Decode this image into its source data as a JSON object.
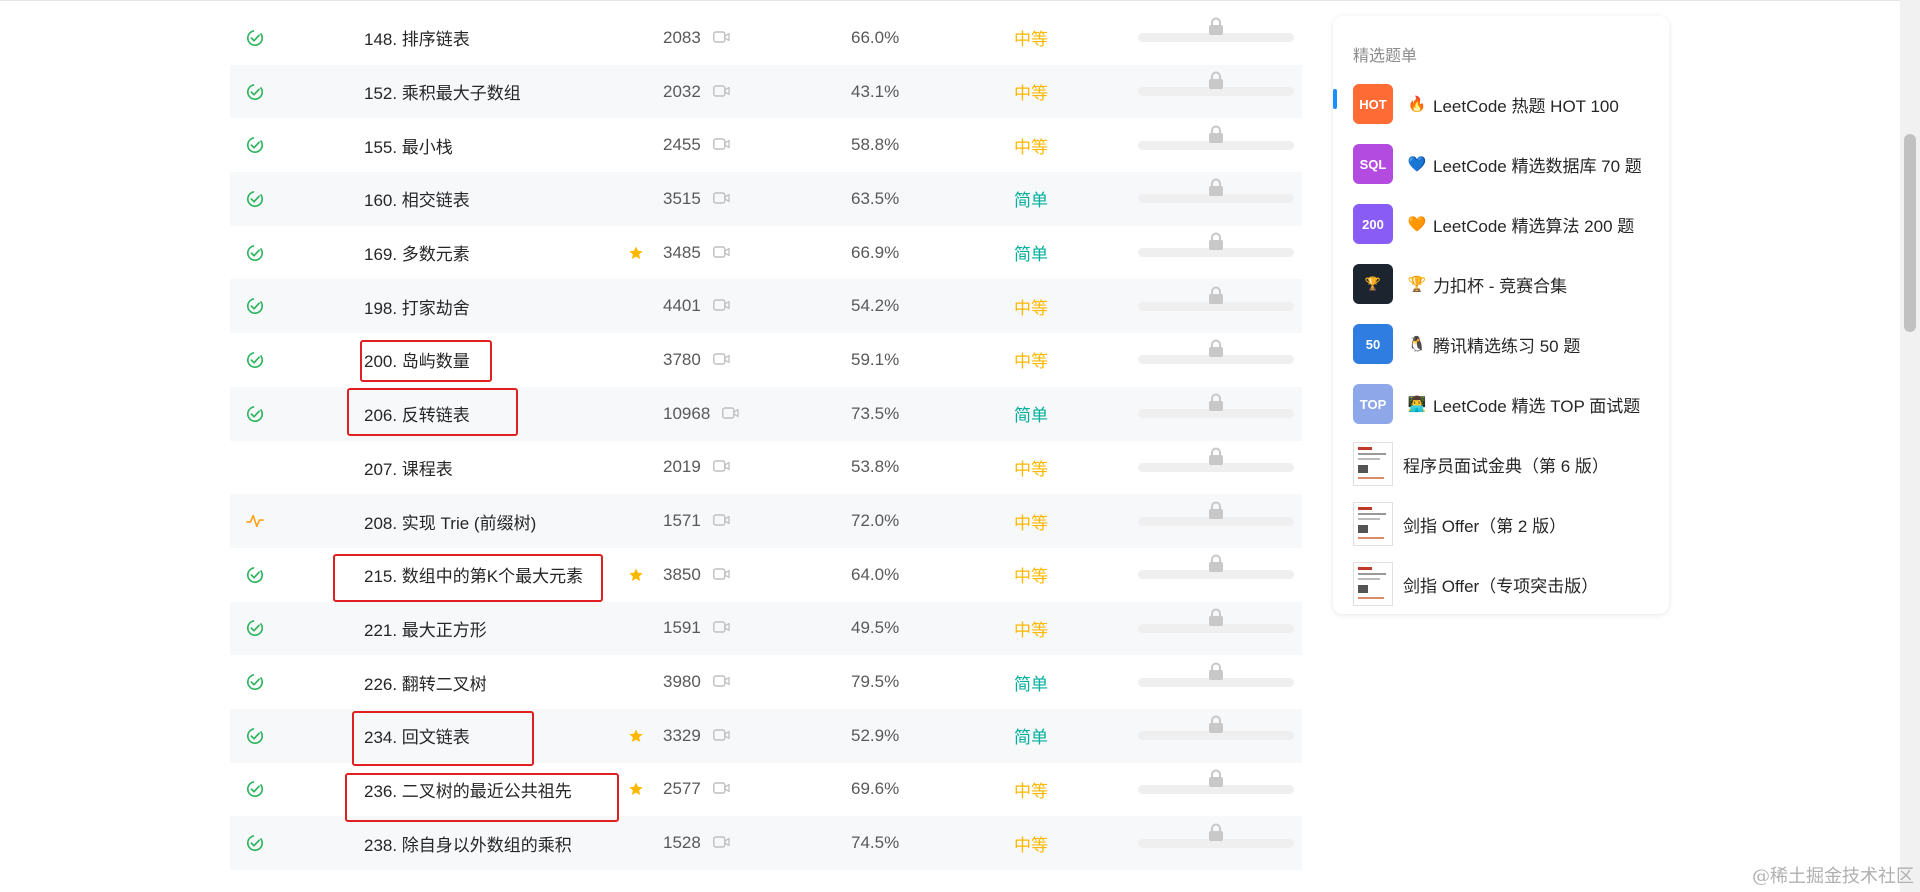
{
  "problems": [
    {
      "status": "solved",
      "title": "148. 排序链表",
      "featured": false,
      "solutions": "2083",
      "acceptance": "66.0%",
      "difficulty": "中等",
      "level": "medium"
    },
    {
      "status": "solved",
      "title": "152. 乘积最大子数组",
      "featured": false,
      "solutions": "2032",
      "acceptance": "43.1%",
      "difficulty": "中等",
      "level": "medium"
    },
    {
      "status": "solved",
      "title": "155. 最小栈",
      "featured": false,
      "solutions": "2455",
      "acceptance": "58.8%",
      "difficulty": "中等",
      "level": "medium"
    },
    {
      "status": "solved",
      "title": "160. 相交链表",
      "featured": false,
      "solutions": "3515",
      "acceptance": "63.5%",
      "difficulty": "简单",
      "level": "easy"
    },
    {
      "status": "solved",
      "title": "169. 多数元素",
      "featured": true,
      "solutions": "3485",
      "acceptance": "66.9%",
      "difficulty": "简单",
      "level": "easy"
    },
    {
      "status": "solved",
      "title": "198. 打家劫舍",
      "featured": false,
      "solutions": "4401",
      "acceptance": "54.2%",
      "difficulty": "中等",
      "level": "medium"
    },
    {
      "status": "solved",
      "title": "200. 岛屿数量",
      "featured": false,
      "solutions": "3780",
      "acceptance": "59.1%",
      "difficulty": "中等",
      "level": "medium"
    },
    {
      "status": "solved",
      "title": "206. 反转链表",
      "featured": false,
      "solutions": "10968",
      "acceptance": "73.5%",
      "difficulty": "简单",
      "level": "easy"
    },
    {
      "status": "none",
      "title": "207. 课程表",
      "featured": false,
      "solutions": "2019",
      "acceptance": "53.8%",
      "difficulty": "中等",
      "level": "medium"
    },
    {
      "status": "attempted",
      "title": "208. 实现 Trie (前缀树)",
      "featured": false,
      "solutions": "1571",
      "acceptance": "72.0%",
      "difficulty": "中等",
      "level": "medium"
    },
    {
      "status": "solved",
      "title": "215. 数组中的第K个最大元素",
      "featured": true,
      "solutions": "3850",
      "acceptance": "64.0%",
      "difficulty": "中等",
      "level": "medium"
    },
    {
      "status": "solved",
      "title": "221. 最大正方形",
      "featured": false,
      "solutions": "1591",
      "acceptance": "49.5%",
      "difficulty": "中等",
      "level": "medium"
    },
    {
      "status": "solved",
      "title": "226. 翻转二叉树",
      "featured": false,
      "solutions": "3980",
      "acceptance": "79.5%",
      "difficulty": "简单",
      "level": "easy"
    },
    {
      "status": "solved",
      "title": "234. 回文链表",
      "featured": true,
      "solutions": "3329",
      "acceptance": "52.9%",
      "difficulty": "简单",
      "level": "easy"
    },
    {
      "status": "solved",
      "title": "236. 二叉树的最近公共祖先",
      "featured": true,
      "solutions": "2577",
      "acceptance": "69.6%",
      "difficulty": "中等",
      "level": "medium"
    },
    {
      "status": "solved",
      "title": "238. 除自身以外数组的乘积",
      "featured": false,
      "solutions": "1528",
      "acceptance": "74.5%",
      "difficulty": "中等",
      "level": "medium"
    }
  ],
  "sidebar": {
    "title": "精选题单",
    "items": [
      {
        "badge": "HOT",
        "icon": "hot-badge-icon",
        "emoji": "🔥",
        "label": "LeetCode 热题 HOT 100",
        "color": "#ff6b35",
        "active": true
      },
      {
        "badge": "SQL",
        "icon": "sql-badge-icon",
        "emoji": "💙",
        "label": "LeetCode 精选数据库 70 题",
        "color": "#b44be1"
      },
      {
        "badge": "200",
        "icon": "200-badge-icon",
        "emoji": "🧡",
        "label": "LeetCode 精选算法 200 题",
        "color": "#8a5cf6"
      },
      {
        "badge": "🏆",
        "icon": "trophy-badge-icon",
        "emoji": "🏆",
        "label": "力扣杯 - 竞赛合集",
        "color": "#1c2430"
      },
      {
        "badge": "50",
        "icon": "50-badge-icon",
        "emoji": "🐧",
        "label": "腾讯精选练习 50 题",
        "color": "#2f7de1"
      },
      {
        "badge": "TOP",
        "icon": "top-badge-icon",
        "emoji": "👨‍💻",
        "label": "LeetCode 精选 TOP 面试题",
        "color": "#8ea7e9"
      },
      {
        "badge": "",
        "icon": "book-cover-icon",
        "emoji": "",
        "label": "程序员面试金典（第 6 版）",
        "color": "#ffffff"
      },
      {
        "badge": "",
        "icon": "book-cover-icon",
        "emoji": "",
        "label": "剑指 Offer（第 2 版）",
        "color": "#ffffff"
      },
      {
        "badge": "",
        "icon": "book-cover-icon",
        "emoji": "",
        "label": "剑指 Offer（专项突击版）",
        "color": "#ffffff"
      }
    ]
  },
  "watermark": "@稀土掘金技术社区",
  "colors": {
    "solved": "#2db55d",
    "attempted": "#ffa116",
    "medium": "#ffb800",
    "easy": "#00af9b",
    "star": "#ffb800",
    "highlight": "#e02020"
  }
}
